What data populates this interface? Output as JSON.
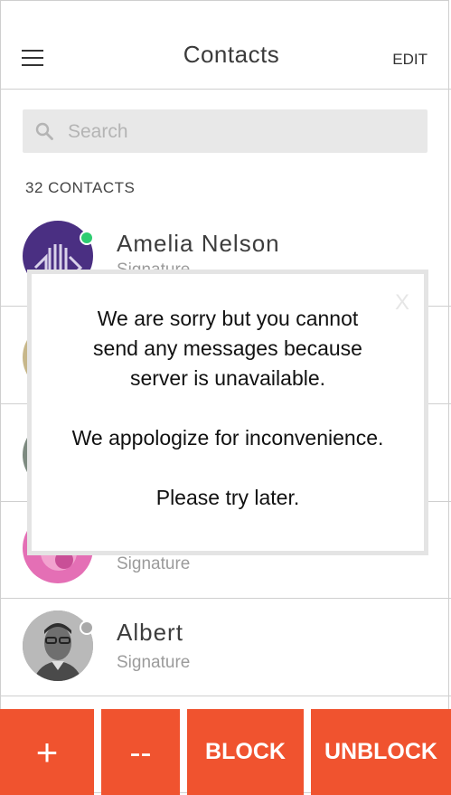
{
  "header": {
    "title": "Contacts",
    "edit_label": "EDIT"
  },
  "search": {
    "placeholder": "Search"
  },
  "contacts_count": "32 CONTACTS",
  "contacts": [
    {
      "name": "Amelia Nelson",
      "signature": "Signature",
      "status": "online",
      "status_color": "#2ecc71"
    },
    {
      "name": "",
      "signature": ""
    },
    {
      "name": "",
      "signature": ""
    },
    {
      "name": "",
      "signature": "Signature"
    },
    {
      "name": "Albert",
      "signature": "Signature",
      "status": "offline",
      "status_color": "#a9a9a9"
    }
  ],
  "dialog": {
    "close_label": "X",
    "line1": "We are sorry but you cannot",
    "line2": "send any messages because",
    "line3": "server is unavailable.",
    "line4": "We appologize for inconvenience.",
    "line5": "Please try later."
  },
  "actions": {
    "add": "+",
    "remove": "--",
    "block": "BLOCK",
    "unblock": "UNBLOCK"
  },
  "colors": {
    "accent": "#f0532f",
    "online": "#2ecc71",
    "offline": "#a9a9a9"
  }
}
